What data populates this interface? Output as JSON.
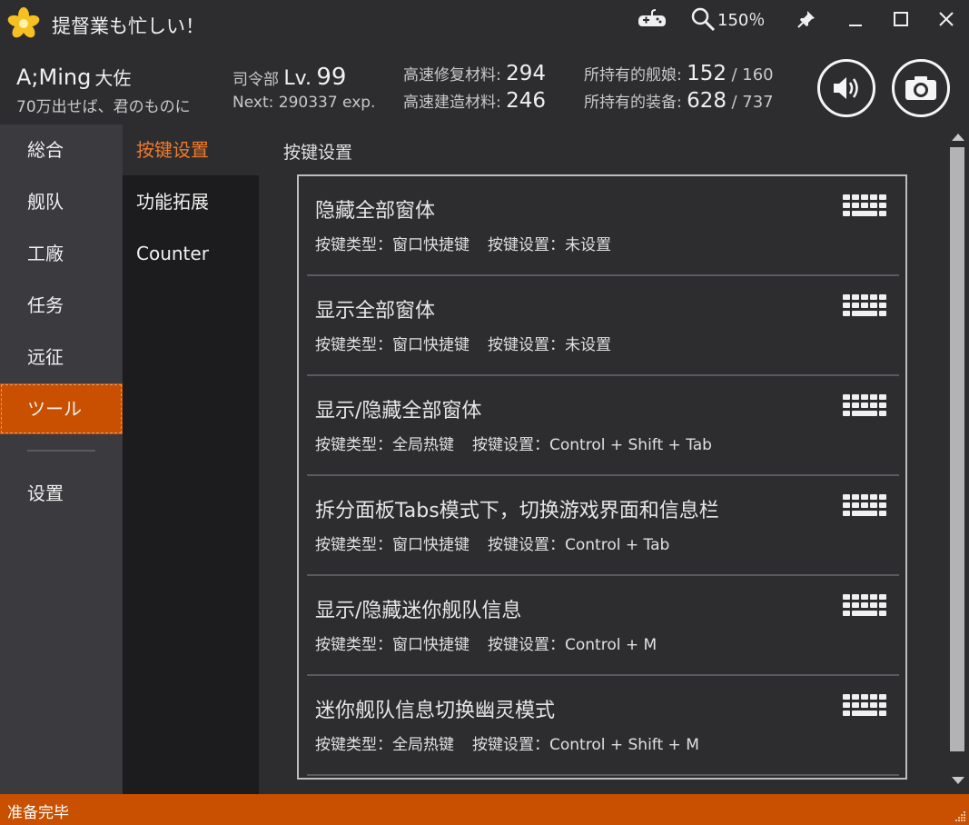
{
  "window": {
    "title": "提督業も忙しい！",
    "zoom": "150％",
    "icons": [
      "app-logo",
      "gamepad-icon",
      "zoom-icon",
      "pin-icon",
      "minimize-icon",
      "maximize-icon",
      "close-icon"
    ]
  },
  "admiral": {
    "name": "A;Ming",
    "rank": "大佐",
    "comment": "70万出せば、君のものに",
    "hq_label": "司令部",
    "lv_label": "Lv.",
    "level": "99",
    "next_label": "Next:",
    "next_exp": "290337 exp."
  },
  "resources": {
    "repair_label": "高速修复材料:",
    "repair_value": "294",
    "build_label": "高速建造材料:",
    "build_value": "246",
    "ships_label": "所持有的舰娘:",
    "ships_value": "152",
    "ships_max": "/ 160",
    "equips_label": "所持有的装备:",
    "equips_value": "628",
    "equips_max": "/ 737"
  },
  "nav": {
    "items": [
      "総合",
      "舰队",
      "工廠",
      "任务",
      "远征",
      "ツール",
      "设置"
    ],
    "active": "ツール"
  },
  "sub_nav": {
    "items": [
      "按键设置",
      "功能拓展",
      "Counter"
    ],
    "active": "按键设置"
  },
  "content": {
    "section_title": "按键设置",
    "type_label": "按键类型：",
    "setting_label": "按键设置：",
    "hotkeys": [
      {
        "name": "隐藏全部窗体",
        "type": "窗口快捷键",
        "setting": "未设置"
      },
      {
        "name": "显示全部窗体",
        "type": "窗口快捷键",
        "setting": "未设置"
      },
      {
        "name": "显示/隐藏全部窗体",
        "type": "全局热键",
        "setting": "Control +  Shift + Tab"
      },
      {
        "name": "拆分面板Tabs模式下，切换游戏界面和信息栏",
        "type": "窗口快捷键",
        "setting": "Control + Tab"
      },
      {
        "name": "显示/隐藏迷你舰队信息",
        "type": "窗口快捷键",
        "setting": "Control + M"
      },
      {
        "name": "迷你舰队信息切换幽灵模式",
        "type": "全局热键",
        "setting": "Control +  Shift + M"
      }
    ]
  },
  "status": {
    "text": "准备完毕"
  },
  "colors": {
    "accent": "#c85000",
    "active_sub_text": "#f07a2a",
    "background": "#2d2d30",
    "nav_bg": "#3a3a3f",
    "sub_nav_bg": "#1c1c1e"
  }
}
